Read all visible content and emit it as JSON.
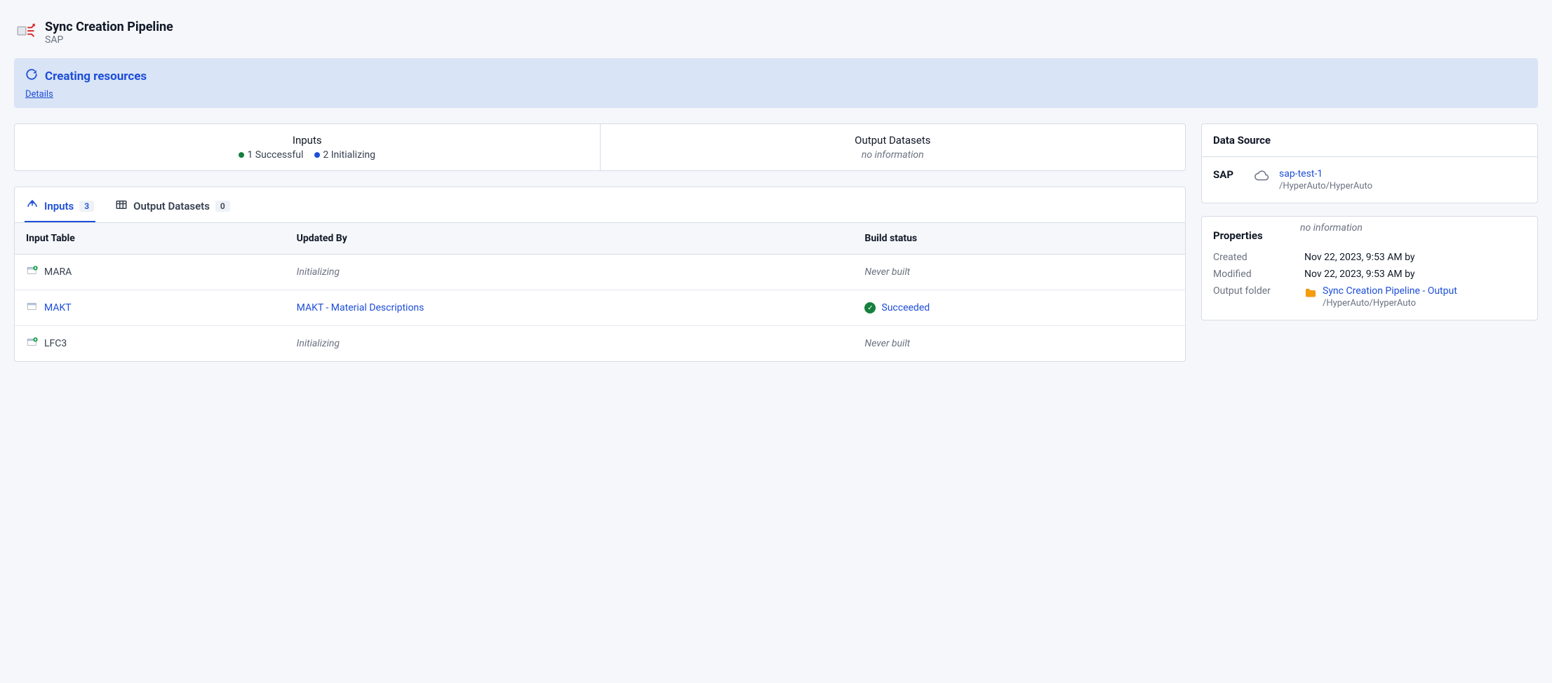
{
  "header": {
    "title": "Sync Creation Pipeline",
    "subtitle": "SAP"
  },
  "status": {
    "title": "Creating resources",
    "details_link": "Details"
  },
  "summary": {
    "inputs": {
      "title": "Inputs",
      "successful_count": "1 Successful",
      "initializing_count": "2 Initializing"
    },
    "outputs": {
      "title": "Output Datasets",
      "subtitle": "no information"
    }
  },
  "tabs": {
    "inputs": {
      "label": "Inputs",
      "count": "3"
    },
    "outputs": {
      "label": "Output Datasets",
      "count": "0"
    }
  },
  "table": {
    "columns": {
      "c0": "Input Table",
      "c1": "Updated By",
      "c2": "Build status"
    },
    "rows": [
      {
        "name": "MARA",
        "is_new": true,
        "updated_by": "Initializing",
        "updated_by_link": false,
        "status": "Never built",
        "status_kind": "muted"
      },
      {
        "name": "MAKT",
        "is_new": false,
        "updated_by": "MAKT - Material Descriptions",
        "updated_by_link": true,
        "status": "Succeeded",
        "status_kind": "success"
      },
      {
        "name": "LFC3",
        "is_new": true,
        "updated_by": "Initializing",
        "updated_by_link": false,
        "status": "Never built",
        "status_kind": "muted"
      }
    ]
  },
  "data_source": {
    "panel_title": "Data Source",
    "label": "SAP",
    "name": "sap-test-1",
    "path": "/HyperAuto/HyperAuto"
  },
  "properties": {
    "panel_title": "Properties",
    "no_info": "no information",
    "created_label": "Created",
    "created_value": "Nov 22, 2023, 9:53 AM by",
    "modified_label": "Modified",
    "modified_value": "Nov 22, 2023, 9:53 AM by",
    "out_folder_label": "Output folder",
    "out_folder_name": "Sync Creation Pipeline - Output",
    "out_folder_path": "/HyperAuto/HyperAuto"
  }
}
